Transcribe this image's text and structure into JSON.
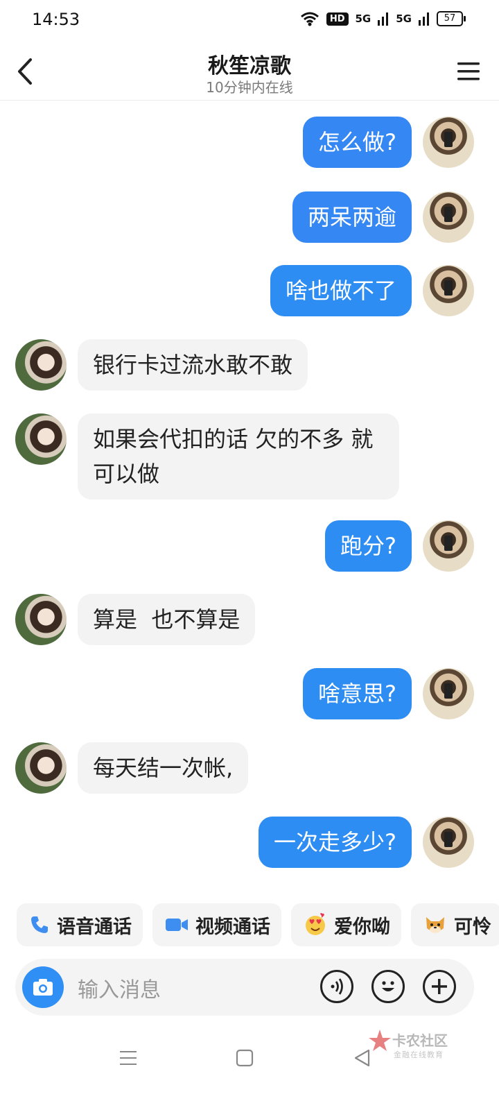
{
  "status": {
    "time": "14:53",
    "hd": "HD",
    "net1": "5G",
    "net2": "5G",
    "battery": "57"
  },
  "header": {
    "title": "秋笙凉歌",
    "subtitle": "10分钟内在线"
  },
  "messages": [
    {
      "dir": "out",
      "text": "怎么做?"
    },
    {
      "dir": "out",
      "text": "两呆两逾"
    },
    {
      "dir": "out",
      "text": "啥也做不了"
    },
    {
      "dir": "in",
      "text": "银行卡过流水敢不敢"
    },
    {
      "dir": "in",
      "text": "如果会代扣的话 欠的不多 就可以做"
    },
    {
      "dir": "out",
      "text": "跑分?"
    },
    {
      "dir": "in",
      "text": "算是  也不算是"
    },
    {
      "dir": "out",
      "text": "啥意思?"
    },
    {
      "dir": "in",
      "text": "每天结一次帐,"
    },
    {
      "dir": "out",
      "text": "一次走多少?"
    }
  ],
  "quick_actions": [
    {
      "label": "语音通话",
      "icon": "phone-icon"
    },
    {
      "label": "视频通话",
      "icon": "video-camera-icon"
    },
    {
      "label": "爱你呦",
      "icon": "heart-eyes-emoji-icon"
    },
    {
      "label": "可怜",
      "icon": "pitiful-dog-emoji-icon"
    }
  ],
  "input": {
    "placeholder": "输入消息"
  },
  "watermark": {
    "title": "卡农社区",
    "subtitle": "金融在线教育"
  },
  "colors": {
    "bubble_out": "#3587f3",
    "bubble_in": "#f3f3f3",
    "camera_button": "#2f8ff5"
  }
}
